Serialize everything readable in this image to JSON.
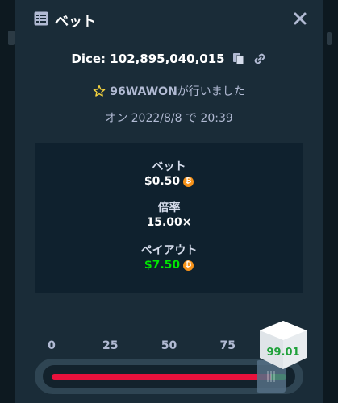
{
  "modal": {
    "title": "ベット",
    "title_icon": "bet-list-icon",
    "close_icon": "close-icon"
  },
  "bet": {
    "dice_id": "Dice: 102,895,040,015",
    "copy_icon": "copy-icon",
    "link_icon": "link-icon",
    "star_icon": "star-icon",
    "user_name": "96WAWON",
    "user_suffix": "が行いました",
    "date_text": "オン 2022/8/8 で 20:39"
  },
  "stats": {
    "bet_label": "ベット",
    "bet_value": "$0.50",
    "multiplier_label": "倍率",
    "multiplier_value": "15.00×",
    "payout_label": "ペイアウト",
    "payout_value": "$7.50",
    "coin_symbol": "₿",
    "coin_icon": "bitcoin-coin-icon",
    "payout_color": "#00e701"
  },
  "slider": {
    "ticks": [
      "0",
      "25",
      "50",
      "75"
    ],
    "target": 93.4,
    "result": "99.01",
    "lose_color": "#e9113c",
    "win_color": "#00e701"
  }
}
